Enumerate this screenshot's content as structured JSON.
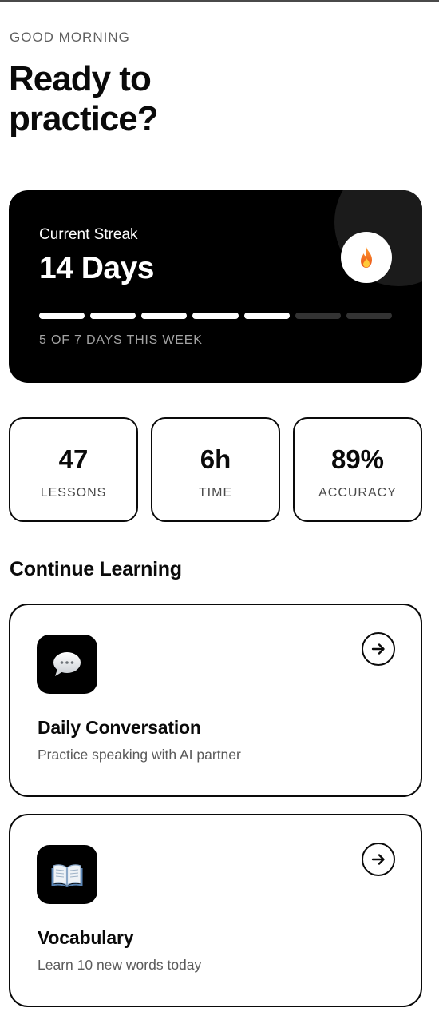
{
  "header": {
    "greeting": "GOOD MORNING",
    "title": "Ready to practice?"
  },
  "streak": {
    "label": "Current Streak",
    "value": "14 Days",
    "icon": "fire-icon",
    "days_completed": 5,
    "days_total": 7,
    "caption": "5 OF 7 DAYS THIS WEEK"
  },
  "stats": [
    {
      "value": "47",
      "label": "LESSONS"
    },
    {
      "value": "6h",
      "label": "TIME"
    },
    {
      "value": "89%",
      "label": "ACCURACY"
    }
  ],
  "section": {
    "title": "Continue Learning"
  },
  "lessons": [
    {
      "title": "Daily Conversation",
      "subtitle": "Practice speaking with AI partner",
      "icon": "speech-bubble-icon",
      "action_icon": "arrow-right-icon"
    },
    {
      "title": "Vocabulary",
      "subtitle": "Learn 10 new words today",
      "icon": "open-book-icon",
      "action_icon": "arrow-right-icon"
    }
  ],
  "colors": {
    "card_dark": "#000000",
    "progress_on": "#ffffff",
    "progress_off": "#333333",
    "fire_orange": "#f2701c"
  }
}
